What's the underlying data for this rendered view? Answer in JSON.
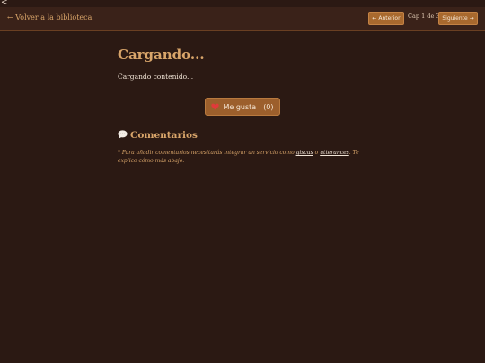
{
  "stray_char": "<",
  "nav": {
    "back": "← Volver a la biblioteca",
    "prev": "← Anterior",
    "chapter_info": "Cap 1 de 3",
    "next": "Siguiente →"
  },
  "content": {
    "title": "Cargando...",
    "loading_text": "Cargando contenido..."
  },
  "like": {
    "label": "Me gusta",
    "count": "(0)",
    "icon": "heart-icon",
    "color": "#e03a3a"
  },
  "comments": {
    "title": "Comentarios",
    "icon": "speech-bubble-icon",
    "note_before": "* Para añadir comentarios necesitarás integrar un servicio como ",
    "link1": "giscus",
    "note_middle": " o ",
    "link2": "utterances",
    "note_after": ". Te explico cómo más abajo."
  },
  "colors": {
    "accent": "#d9a56a",
    "button": "#a8692e",
    "background": "#2b1913"
  }
}
